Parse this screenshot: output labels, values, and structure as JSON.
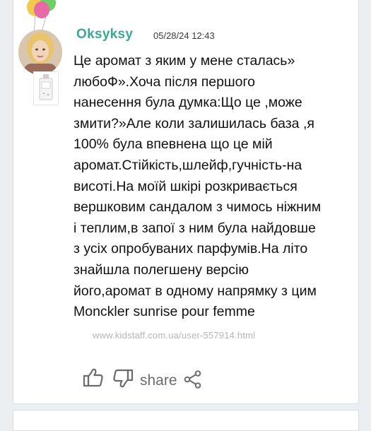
{
  "review": {
    "username": "Oksyksy",
    "timestamp": "05/28/24 12:43",
    "text_lines": [
      "Це аромат з яким у мене сталась»",
      "любоФ».Хоча після першого",
      "нанесення була думка:Що це ,може",
      "змити?»Але коли залишилась база ,я",
      "100% була впевнена що це мій",
      "аромат.Стійкість,шлейф,гучність-на",
      "висоті.На моїй шкірі розкривається",
      "вершковим сандалом з чимось ніжним",
      "і теплим,в запої з ним була найдовше",
      "з усіх опробуваних парфумів.На літо",
      "знайшла полегшену версію",
      "його,аромат в одному напрямку з цим",
      "Monckler sunrise pour femme"
    ],
    "watermark": "www.kidstaff.com.ua/user-557914.html"
  },
  "actions": {
    "like_icon": "thumbs-up-icon",
    "dislike_icon": "thumbs-down-icon",
    "share_label": "share",
    "share_icon": "share-icon"
  },
  "colors": {
    "username": "#3aa896",
    "text": "#111111",
    "icon": "#6b6b6b",
    "watermark": "#b7b7b7",
    "background": "#eceff1"
  }
}
